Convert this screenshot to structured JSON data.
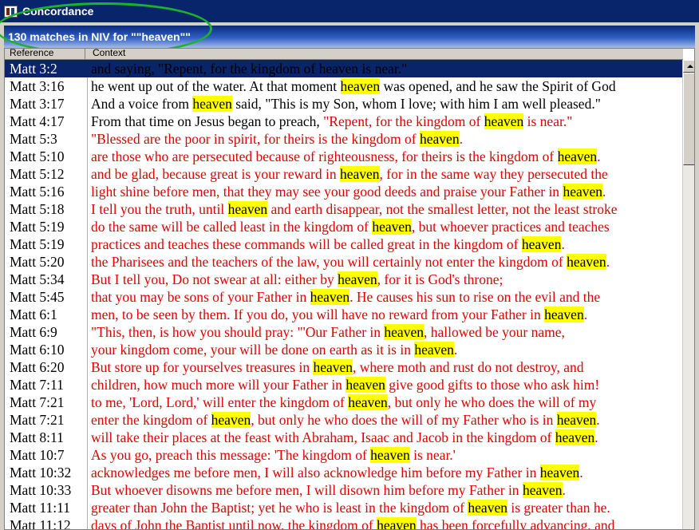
{
  "window": {
    "title": "Concordance"
  },
  "matchbar": {
    "text": "130 matches in NIV for \"\"heaven\"\""
  },
  "columns": {
    "reference": "Reference",
    "context": "Context"
  },
  "colors": {
    "red_letter": "#e00000",
    "highlight": "#ffff00",
    "selection": "#0a246a",
    "ellipse": "#19b42c"
  },
  "rows": [
    {
      "ref": "Matt 3:2",
      "selected": true,
      "segments": [
        {
          "t": "and saying, \"Repent, for the kingdom of heaven is near.\"",
          "c": "k"
        }
      ]
    },
    {
      "ref": "Matt 3:16",
      "segments": [
        {
          "t": "he went up out of the water. At that moment ",
          "c": "k"
        },
        {
          "t": "heaven",
          "c": "k",
          "h": true
        },
        {
          "t": " was opened, and he saw the Spirit of God",
          "c": "k"
        }
      ]
    },
    {
      "ref": "Matt 3:17",
      "segments": [
        {
          "t": "And a voice from ",
          "c": "k"
        },
        {
          "t": "heaven",
          "c": "k",
          "h": true
        },
        {
          "t": " said, \"This is my Son, whom I love; with him I am well pleased.\"",
          "c": "k"
        }
      ]
    },
    {
      "ref": "Matt 4:17",
      "segments": [
        {
          "t": "From that time on Jesus began to preach, ",
          "c": "k"
        },
        {
          "t": "\"Repent, for the kingdom of ",
          "c": "r"
        },
        {
          "t": "heaven",
          "c": "r",
          "h": true
        },
        {
          "t": " is near.\"",
          "c": "r"
        }
      ]
    },
    {
      "ref": "Matt 5:3",
      "segments": [
        {
          "t": "\"Blessed are the poor in spirit, for theirs is the kingdom of ",
          "c": "r"
        },
        {
          "t": "heaven",
          "c": "r",
          "h": true
        },
        {
          "t": ".",
          "c": "r"
        }
      ]
    },
    {
      "ref": "Matt 5:10",
      "segments": [
        {
          "t": "are those who are persecuted because of righteousness, for theirs is the kingdom of ",
          "c": "r"
        },
        {
          "t": "heaven",
          "c": "r",
          "h": true
        },
        {
          "t": ".",
          "c": "r"
        }
      ]
    },
    {
      "ref": "Matt 5:12",
      "segments": [
        {
          "t": "and be glad, because great is your reward in ",
          "c": "r"
        },
        {
          "t": "heaven",
          "c": "r",
          "h": true
        },
        {
          "t": ", for in the same way they persecuted the",
          "c": "r"
        }
      ]
    },
    {
      "ref": "Matt 5:16",
      "segments": [
        {
          "t": "light shine before men, that they may see your good deeds and praise your Father in ",
          "c": "r"
        },
        {
          "t": "heaven",
          "c": "r",
          "h": true
        },
        {
          "t": ".",
          "c": "r"
        }
      ]
    },
    {
      "ref": "Matt 5:18",
      "segments": [
        {
          "t": "I tell you the truth, until ",
          "c": "r"
        },
        {
          "t": "heaven",
          "c": "r",
          "h": true
        },
        {
          "t": " and earth disappear, not the smallest letter, not the least stroke",
          "c": "r"
        }
      ]
    },
    {
      "ref": "Matt 5:19",
      "segments": [
        {
          "t": "do the same will be called least in the kingdom of ",
          "c": "r"
        },
        {
          "t": "heaven",
          "c": "r",
          "h": true
        },
        {
          "t": ", but whoever practices and teaches",
          "c": "r"
        }
      ]
    },
    {
      "ref": "Matt 5:19",
      "segments": [
        {
          "t": "practices and teaches these commands will be called great in the kingdom of ",
          "c": "r"
        },
        {
          "t": "heaven",
          "c": "r",
          "h": true
        },
        {
          "t": ".",
          "c": "r"
        }
      ]
    },
    {
      "ref": "Matt 5:20",
      "segments": [
        {
          "t": "the Pharisees and the teachers of the law, you will certainly not enter the kingdom of ",
          "c": "r"
        },
        {
          "t": "heaven",
          "c": "r",
          "h": true
        },
        {
          "t": ".",
          "c": "r"
        }
      ]
    },
    {
      "ref": "Matt 5:34",
      "segments": [
        {
          "t": "But I tell you, Do not swear at all: either by ",
          "c": "r"
        },
        {
          "t": "heaven",
          "c": "r",
          "h": true
        },
        {
          "t": ", for it is God's throne;",
          "c": "r"
        }
      ]
    },
    {
      "ref": "Matt 5:45",
      "segments": [
        {
          "t": "that you may be sons of your Father in ",
          "c": "r"
        },
        {
          "t": "heaven",
          "c": "r",
          "h": true
        },
        {
          "t": ". He causes his sun to rise on the evil and the",
          "c": "r"
        }
      ]
    },
    {
      "ref": "Matt 6:1",
      "segments": [
        {
          "t": "men, to be seen by them. If you do, you will have no reward from your Father in ",
          "c": "r"
        },
        {
          "t": "heaven",
          "c": "r",
          "h": true
        },
        {
          "t": ".",
          "c": "r"
        }
      ]
    },
    {
      "ref": "Matt 6:9",
      "segments": [
        {
          "t": "\"This, then, is how you should pray: \"'Our Father in ",
          "c": "r"
        },
        {
          "t": "heaven",
          "c": "r",
          "h": true
        },
        {
          "t": ", hallowed be your name,",
          "c": "r"
        }
      ]
    },
    {
      "ref": "Matt 6:10",
      "segments": [
        {
          "t": "your kingdom come, your will be done on earth as it is in ",
          "c": "r"
        },
        {
          "t": "heaven",
          "c": "r",
          "h": true
        },
        {
          "t": ".",
          "c": "r"
        }
      ]
    },
    {
      "ref": "Matt 6:20",
      "segments": [
        {
          "t": "But store up for yourselves treasures in ",
          "c": "r"
        },
        {
          "t": "heaven",
          "c": "r",
          "h": true
        },
        {
          "t": ", where moth and rust do not destroy, and",
          "c": "r"
        }
      ]
    },
    {
      "ref": "Matt 7:11",
      "segments": [
        {
          "t": "children, how much more will your Father in ",
          "c": "r"
        },
        {
          "t": "heaven",
          "c": "r",
          "h": true
        },
        {
          "t": " give good gifts to those who ask him!",
          "c": "r"
        }
      ]
    },
    {
      "ref": "Matt 7:21",
      "segments": [
        {
          "t": "to me, 'Lord, Lord,' will enter the kingdom of ",
          "c": "r"
        },
        {
          "t": "heaven",
          "c": "r",
          "h": true
        },
        {
          "t": ", but only he who does the will of my",
          "c": "r"
        }
      ]
    },
    {
      "ref": "Matt 7:21",
      "segments": [
        {
          "t": "enter the kingdom of ",
          "c": "r"
        },
        {
          "t": "heaven",
          "c": "r",
          "h": true
        },
        {
          "t": ", but only he who does the will of my Father who is in ",
          "c": "r"
        },
        {
          "t": "heaven",
          "c": "r",
          "h": true
        },
        {
          "t": ".",
          "c": "r"
        }
      ]
    },
    {
      "ref": "Matt 8:11",
      "segments": [
        {
          "t": "will take their places at the feast with Abraham, Isaac and Jacob in the kingdom of ",
          "c": "r"
        },
        {
          "t": "heaven",
          "c": "r",
          "h": true
        },
        {
          "t": ".",
          "c": "r"
        }
      ]
    },
    {
      "ref": "Matt 10:7",
      "segments": [
        {
          "t": "As you go, preach this message: 'The kingdom of ",
          "c": "r"
        },
        {
          "t": "heaven",
          "c": "r",
          "h": true
        },
        {
          "t": " is near.'",
          "c": "r"
        }
      ]
    },
    {
      "ref": "Matt 10:32",
      "segments": [
        {
          "t": "acknowledges me before men, I will also acknowledge him before my Father in ",
          "c": "r"
        },
        {
          "t": "heaven",
          "c": "r",
          "h": true
        },
        {
          "t": ".",
          "c": "r"
        }
      ]
    },
    {
      "ref": "Matt 10:33",
      "segments": [
        {
          "t": "But whoever disowns me before men, I will disown him before my Father in ",
          "c": "r"
        },
        {
          "t": "heaven",
          "c": "r",
          "h": true
        },
        {
          "t": ".",
          "c": "r"
        }
      ]
    },
    {
      "ref": "Matt 11:11",
      "segments": [
        {
          "t": "greater than John the Baptist; yet he who is least in the kingdom of ",
          "c": "r"
        },
        {
          "t": "heaven",
          "c": "r",
          "h": true
        },
        {
          "t": " is greater than he.",
          "c": "r"
        }
      ]
    },
    {
      "ref": "Matt 11:12",
      "segments": [
        {
          "t": "days of John the Baptist until now, the kingdom of ",
          "c": "r"
        },
        {
          "t": "heaven",
          "c": "r",
          "h": true
        },
        {
          "t": " has been forcefully advancing, and",
          "c": "r"
        }
      ]
    }
  ]
}
